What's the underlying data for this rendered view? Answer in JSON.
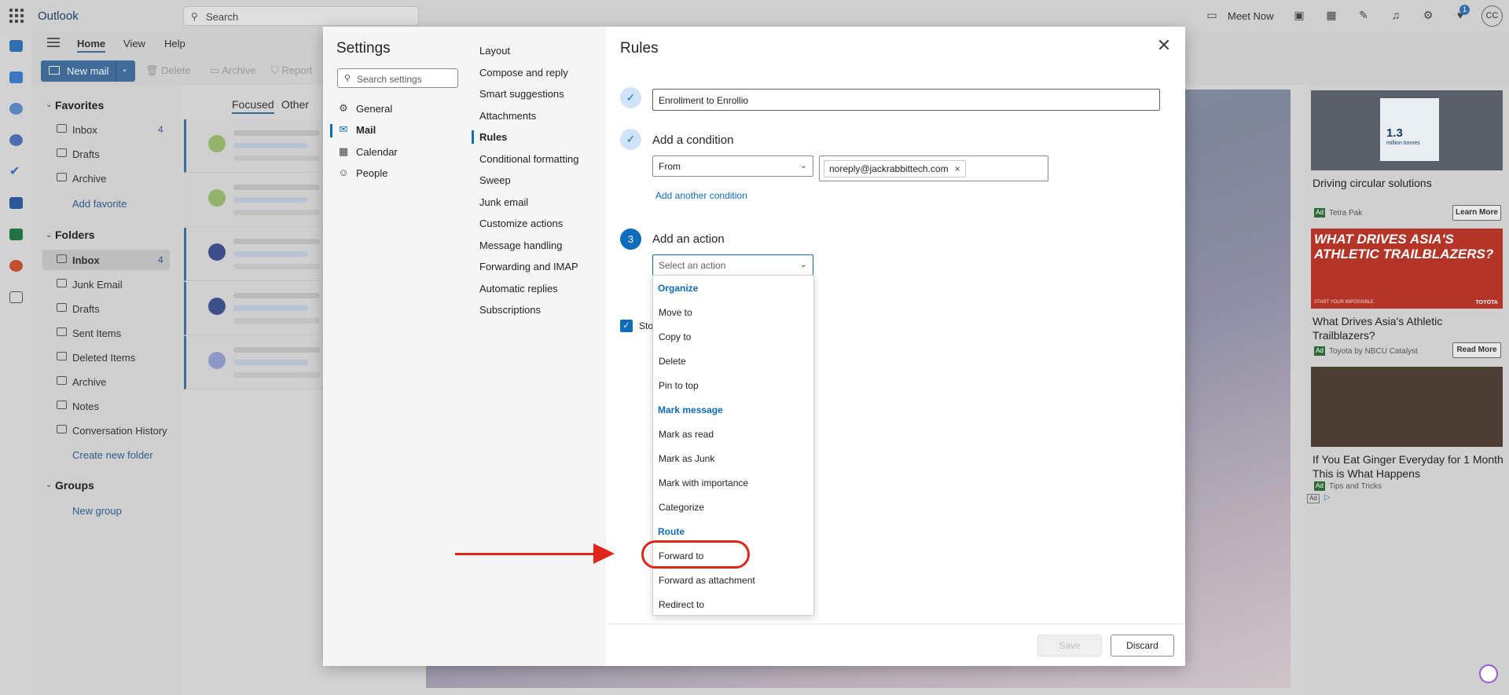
{
  "app": {
    "name": "Outlook",
    "search_placeholder": "Search",
    "meet_now": "Meet Now",
    "avatar_initials": "CC",
    "notification_count": "1"
  },
  "ribbon": {
    "tabs": [
      "Home",
      "View",
      "Help"
    ],
    "new_mail": "New mail",
    "delete": "Delete",
    "archive": "Archive",
    "report": "Report"
  },
  "folders": {
    "favorites_header": "Favorites",
    "favorites": [
      {
        "label": "Inbox",
        "count": "4"
      },
      {
        "label": "Drafts"
      },
      {
        "label": "Archive"
      }
    ],
    "add_favorite": "Add favorite",
    "folders_header": "Folders",
    "items": [
      {
        "label": "Inbox",
        "count": "4"
      },
      {
        "label": "Junk Email"
      },
      {
        "label": "Drafts"
      },
      {
        "label": "Sent Items"
      },
      {
        "label": "Deleted Items"
      },
      {
        "label": "Archive"
      },
      {
        "label": "Notes"
      },
      {
        "label": "Conversation History"
      }
    ],
    "create_folder": "Create new folder",
    "groups_header": "Groups",
    "new_group": "New group"
  },
  "maillist": {
    "tabs": [
      "Focused",
      "Other"
    ]
  },
  "ads": [
    {
      "title": "Driving circular solutions",
      "source": "Tetra Pak",
      "button": "Learn More",
      "badge": "Ad"
    },
    {
      "title": "What Drives Asia's Athletic Trailblazers?",
      "source": "Toyota by NBCU Catalyst",
      "button": "Read More",
      "badge": "Ad"
    },
    {
      "title": "If You Eat Ginger Everyday for 1 Month This is What Happens",
      "source": "Tips and Tricks",
      "badge": "Ad"
    }
  ],
  "ad_images": [
    {
      "caption_big": "1.3",
      "caption_small": "million tonnes"
    },
    {
      "headline": "WHAT DRIVES ASIA'S ATHLETIC TRAILBLAZERS?",
      "tagline": "START YOUR IMPOSSIBLE",
      "brand": "TOYOTA"
    }
  ],
  "ad_footer_badge": "Ad",
  "settings": {
    "title": "Settings",
    "search_placeholder": "Search settings",
    "categories": [
      "General",
      "Mail",
      "Calendar",
      "People"
    ],
    "subcategories": [
      "Layout",
      "Compose and reply",
      "Smart suggestions",
      "Attachments",
      "Rules",
      "Conditional formatting",
      "Sweep",
      "Junk email",
      "Customize actions",
      "Message handling",
      "Forwarding and IMAP",
      "Automatic replies",
      "Subscriptions"
    ]
  },
  "rules": {
    "title": "Rules",
    "rule_name": "Enrollment to Enrollio",
    "condition_label": "Add a condition",
    "condition_field": "From",
    "condition_value": "noreply@jackrabbittech.com",
    "add_another_condition": "Add another condition",
    "action_step": "3",
    "action_label": "Add an action",
    "action_placeholder": "Select an action",
    "stop_label": "Sto",
    "save": "Save",
    "discard": "Discard"
  },
  "action_menu": {
    "groups": [
      {
        "header": "Organize",
        "items": [
          "Move to",
          "Copy to",
          "Delete",
          "Pin to top"
        ]
      },
      {
        "header": "Mark message",
        "items": [
          "Mark as read",
          "Mark as Junk",
          "Mark with importance",
          "Categorize"
        ]
      },
      {
        "header": "Route",
        "items": [
          "Forward to",
          "Forward as attachment",
          "Redirect to"
        ]
      }
    ]
  },
  "icons": {
    "close": "✕",
    "check": "✓",
    "chevron": "⌄",
    "search": "⚲",
    "gear": "⚙",
    "remove": "×"
  },
  "colors": {
    "accent": "#0f6cbd",
    "annotation": "#e0261a"
  }
}
